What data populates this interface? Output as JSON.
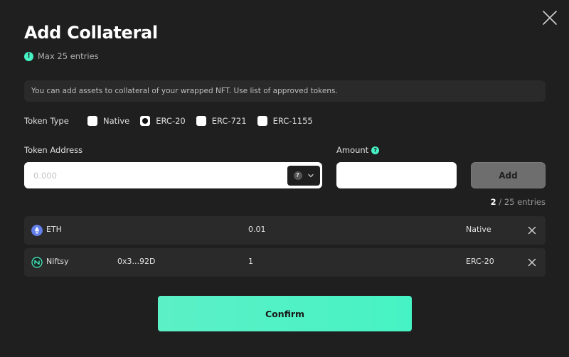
{
  "modal": {
    "title": "Add Collateral",
    "max_note": "Max 25 entries",
    "info": "You can add assets to collateral of your wrapped NFT. Use list of approved tokens.",
    "accent_color": "#46f3c4"
  },
  "token_type": {
    "label": "Token Type",
    "options": [
      "Native",
      "ERC-20",
      "ERC-721",
      "ERC-1155"
    ],
    "selected": "ERC-20"
  },
  "form": {
    "address_label": "Token Address",
    "address_placeholder": "0.000",
    "amount_label": "Amount",
    "add_label": "Add"
  },
  "counter": {
    "current": "2",
    "rest": " / 25 entries"
  },
  "entries": [
    {
      "token": "ETH",
      "address": "",
      "amount": "0.01",
      "type": "Native",
      "icon": "ethereum-icon"
    },
    {
      "token": "Niftsy",
      "address": "0x3...92D",
      "amount": "1",
      "type": "ERC-20",
      "icon": "niftsy-icon"
    }
  ],
  "confirm_label": "Confirm"
}
